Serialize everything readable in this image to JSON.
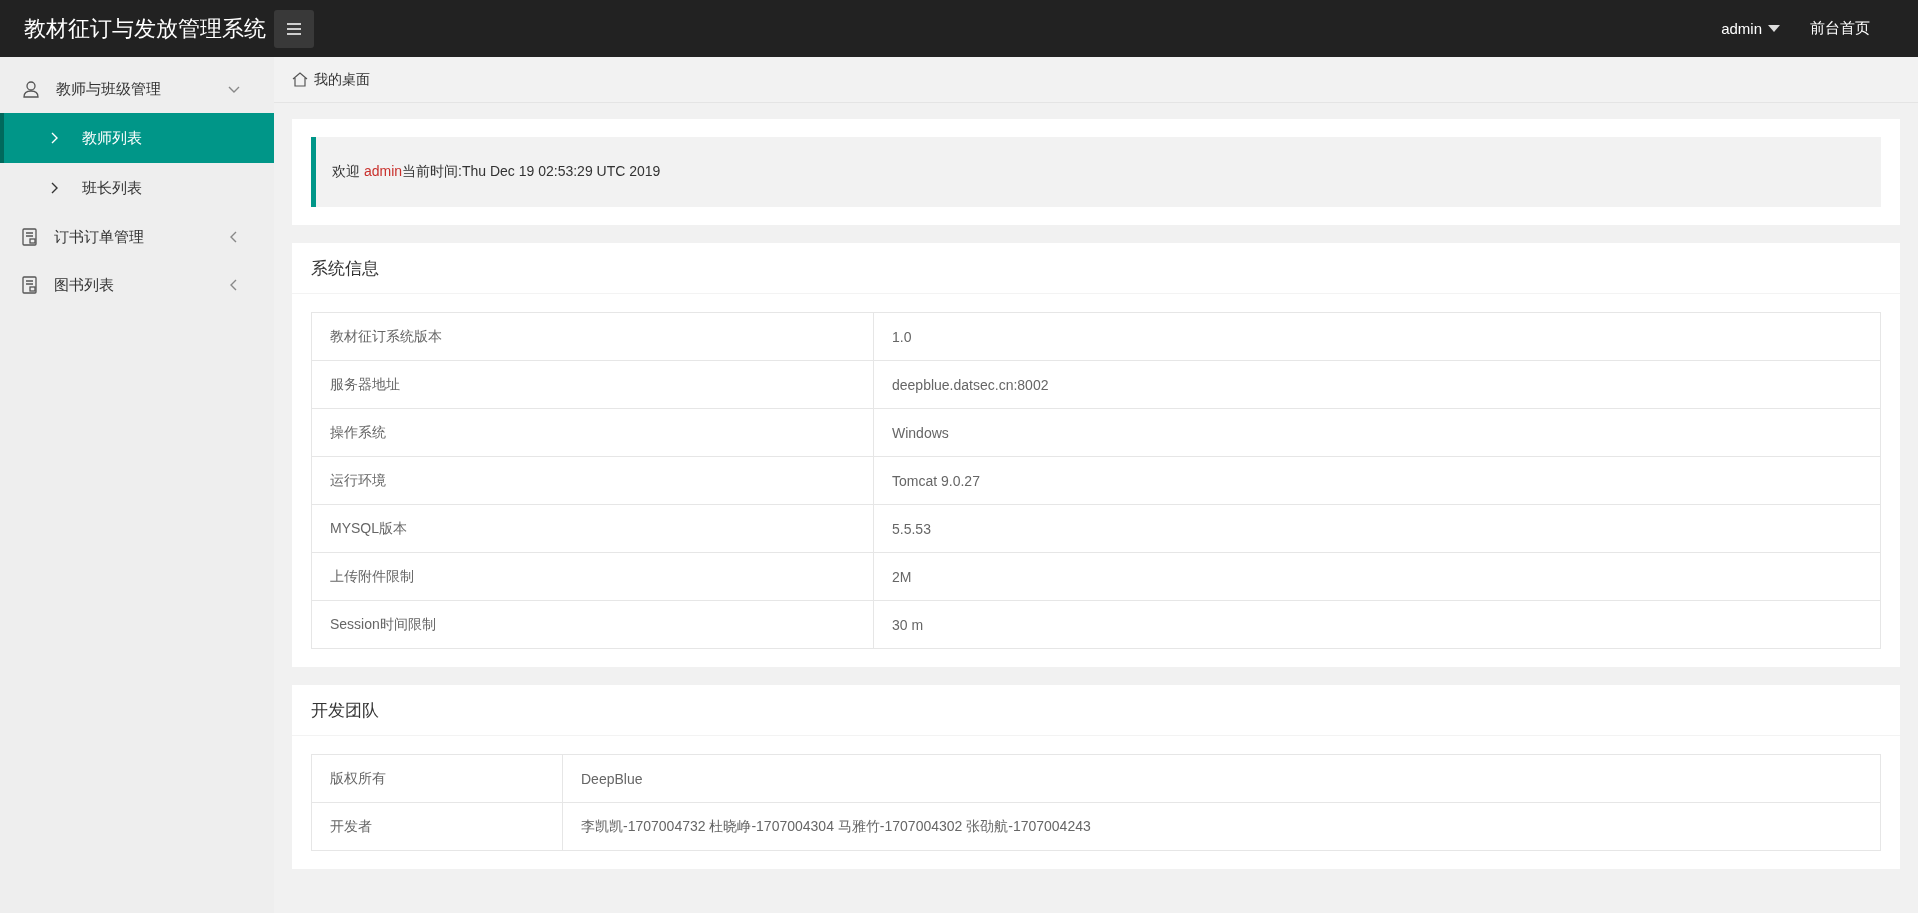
{
  "header": {
    "title": "教材征订与发放管理系统",
    "user": "admin",
    "link": "前台首页"
  },
  "sidebar": {
    "groups": [
      {
        "label": "教师与班级管理",
        "kind": "user",
        "expanded": true,
        "children": [
          {
            "label": "教师列表",
            "selected": true
          },
          {
            "label": "班长列表",
            "selected": false
          }
        ]
      },
      {
        "label": "订书订单管理",
        "kind": "doc",
        "expanded": false
      },
      {
        "label": "图书列表",
        "kind": "doc",
        "expanded": false
      }
    ]
  },
  "breadcrumb": "我的桌面",
  "welcome": {
    "greeting": "欢迎 ",
    "user": "admin",
    "text": "当前时间:Thu Dec 19 02:53:29 UTC 2019"
  },
  "panels": [
    {
      "title": "系统信息",
      "rows": [
        {
          "label": "教材征订系统版本",
          "value": "1.0"
        },
        {
          "label": "服务器地址",
          "value": "deepblue.datsec.cn:8002"
        },
        {
          "label": "操作系统",
          "value": "Windows"
        },
        {
          "label": "运行环境",
          "value": "Tomcat 9.0.27"
        },
        {
          "label": "MYSQL版本",
          "value": "5.5.53"
        },
        {
          "label": "上传附件限制",
          "value": "2M"
        },
        {
          "label": "Session时间限制",
          "value": "30 m"
        }
      ]
    },
    {
      "title": "开发团队",
      "rows": [
        {
          "label": "版权所有",
          "value": "DeepBlue"
        },
        {
          "label": "开发者",
          "value": "李凯凯-1707004732 杜晓峥-1707004304 马雅竹-1707004302 张劭航-1707004243"
        }
      ]
    }
  ]
}
